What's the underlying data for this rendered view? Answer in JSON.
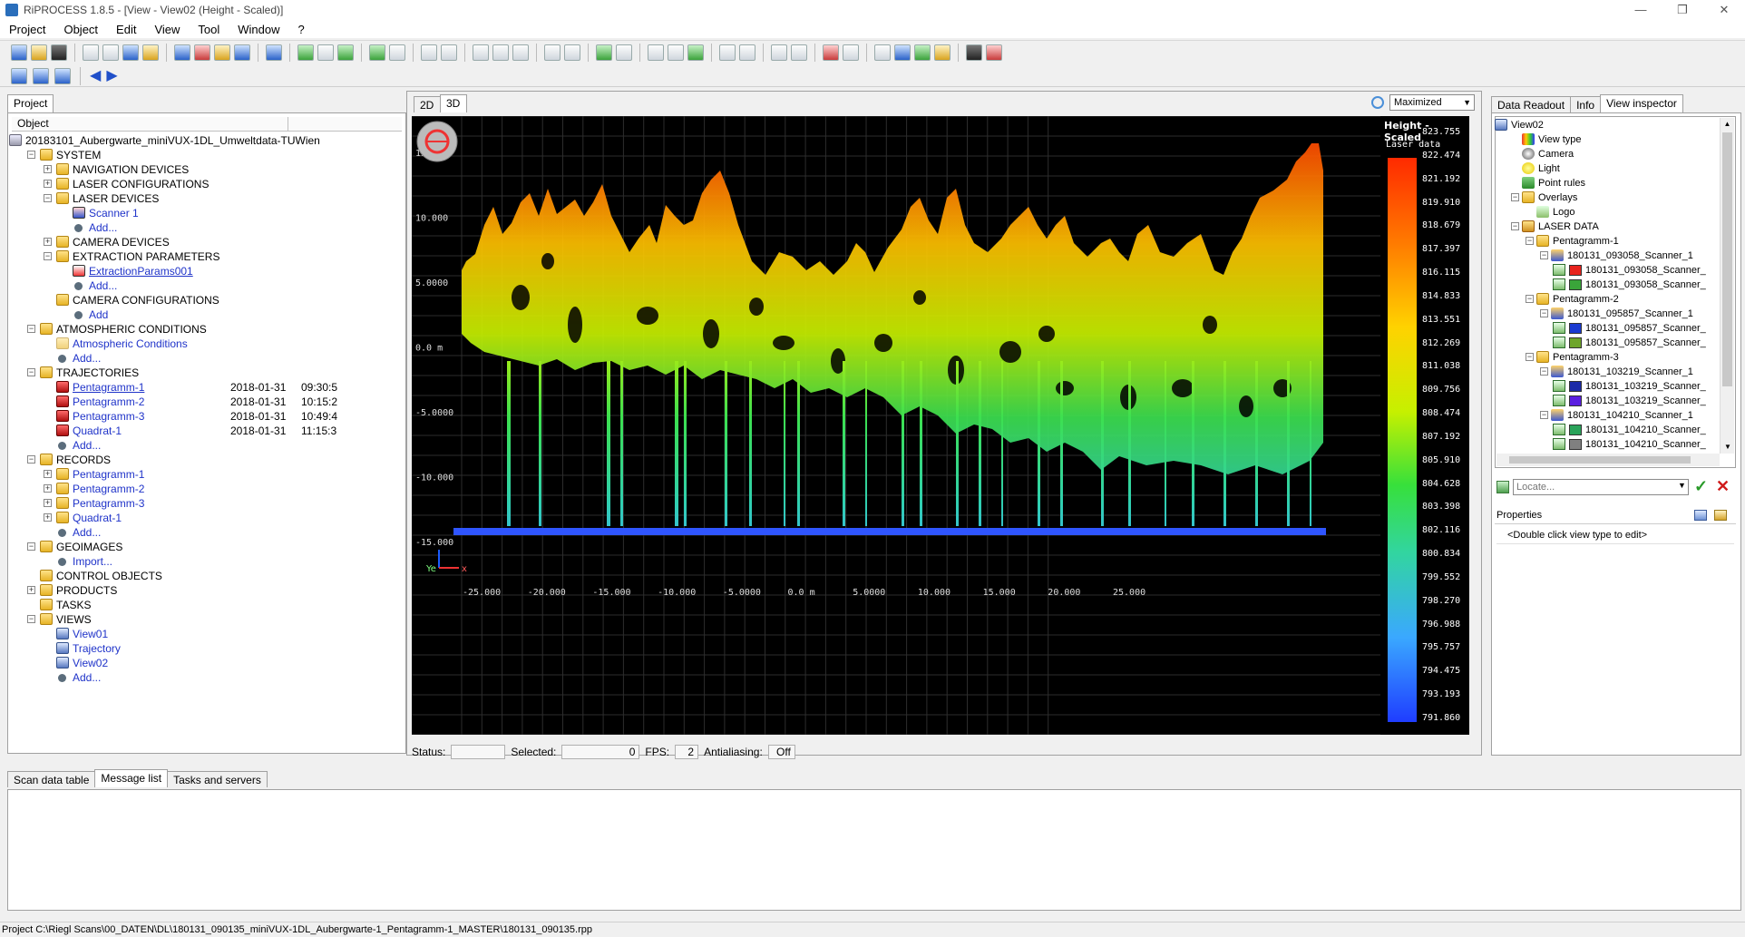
{
  "window": {
    "title": "RiPROCESS 1.8.5 - [View - View02 (Height - Scaled)]",
    "controls": [
      "—",
      "❐",
      "✕"
    ]
  },
  "menu": [
    "Project",
    "Object",
    "Edit",
    "View",
    "Tool",
    "Window",
    "?"
  ],
  "left_panel": {
    "tab": "Project",
    "column_header": "Object",
    "tree": [
      {
        "label": "20183101_Aubergwarte_miniVUX-1DL_Umweltdata-TUWien",
        "indent": 0,
        "type": "root"
      },
      {
        "label": "SYSTEM",
        "indent": 1,
        "type": "folder",
        "pm": "−"
      },
      {
        "label": "NAVIGATION DEVICES",
        "indent": 2,
        "type": "folder",
        "pm": "+"
      },
      {
        "label": "LASER CONFIGURATIONS",
        "indent": 2,
        "type": "folder",
        "pm": "+"
      },
      {
        "label": "LASER DEVICES",
        "indent": 2,
        "type": "folder",
        "pm": "−"
      },
      {
        "label": "Scanner 1",
        "indent": 3,
        "type": "scanner",
        "cls": "blue"
      },
      {
        "label": "Add...",
        "indent": 3,
        "type": "dot",
        "cls": "blue"
      },
      {
        "label": "CAMERA DEVICES",
        "indent": 2,
        "type": "folder",
        "pm": "+"
      },
      {
        "label": "EXTRACTION PARAMETERS",
        "indent": 2,
        "type": "folder",
        "pm": "−"
      },
      {
        "label": "ExtractionParams001",
        "indent": 3,
        "type": "param",
        "cls": "blue ul"
      },
      {
        "label": "Add...",
        "indent": 3,
        "type": "dot",
        "cls": "blue"
      },
      {
        "label": "CAMERA CONFIGURATIONS",
        "indent": 2,
        "type": "folder"
      },
      {
        "label": "Add",
        "indent": 3,
        "type": "dot",
        "cls": "blue"
      },
      {
        "label": "ATMOSPHERIC CONDITIONS",
        "indent": 1,
        "type": "folder",
        "pm": "−"
      },
      {
        "label": "Atmospheric Conditions",
        "indent": 2,
        "type": "folderlight",
        "cls": "blue"
      },
      {
        "label": "Add...",
        "indent": 2,
        "type": "dot",
        "cls": "blue"
      },
      {
        "label": "TRAJECTORIES",
        "indent": 1,
        "type": "folder",
        "pm": "−"
      },
      {
        "label": "Pentagramm-1",
        "indent": 2,
        "type": "traj",
        "cls": "blue ul",
        "date": "2018-01-31",
        "time": "09:30:5"
      },
      {
        "label": "Pentagramm-2",
        "indent": 2,
        "type": "traj",
        "cls": "blue",
        "date": "2018-01-31",
        "time": "10:15:2"
      },
      {
        "label": "Pentagramm-3",
        "indent": 2,
        "type": "traj",
        "cls": "blue",
        "date": "2018-01-31",
        "time": "10:49:4"
      },
      {
        "label": "Quadrat-1",
        "indent": 2,
        "type": "traj",
        "cls": "blue",
        "date": "2018-01-31",
        "time": "11:15:3"
      },
      {
        "label": "Add...",
        "indent": 2,
        "type": "dot",
        "cls": "blue"
      },
      {
        "label": "RECORDS",
        "indent": 1,
        "type": "folder",
        "pm": "−"
      },
      {
        "label": "Pentagramm-1",
        "indent": 2,
        "type": "folder",
        "pm": "+",
        "cls": "blue"
      },
      {
        "label": "Pentagramm-2",
        "indent": 2,
        "type": "folder",
        "pm": "+",
        "cls": "blue"
      },
      {
        "label": "Pentagramm-3",
        "indent": 2,
        "type": "folder",
        "pm": "+",
        "cls": "blue"
      },
      {
        "label": "Quadrat-1",
        "indent": 2,
        "type": "folder",
        "pm": "+",
        "cls": "blue"
      },
      {
        "label": "Add...",
        "indent": 2,
        "type": "dot",
        "cls": "blue"
      },
      {
        "label": "GEOIMAGES",
        "indent": 1,
        "type": "folder",
        "pm": "−"
      },
      {
        "label": "Import...",
        "indent": 2,
        "type": "dot",
        "cls": "blue"
      },
      {
        "label": "CONTROL OBJECTS",
        "indent": 1,
        "type": "folder"
      },
      {
        "label": "PRODUCTS",
        "indent": 1,
        "type": "folder",
        "pm": "+"
      },
      {
        "label": "TASKS",
        "indent": 1,
        "type": "folder"
      },
      {
        "label": "VIEWS",
        "indent": 1,
        "type": "folder",
        "pm": "−"
      },
      {
        "label": "View01",
        "indent": 2,
        "type": "view",
        "cls": "blue"
      },
      {
        "label": "Trajectory",
        "indent": 2,
        "type": "view",
        "cls": "blue"
      },
      {
        "label": "View02",
        "indent": 2,
        "type": "view",
        "cls": "blue"
      },
      {
        "label": "Add...",
        "indent": 2,
        "type": "dot",
        "cls": "blue"
      }
    ]
  },
  "view": {
    "tabs": [
      "2D",
      "3D"
    ],
    "layout_select": "Maximized",
    "legend_title": "Height - Scaled",
    "legend_subtitle": "Laser data",
    "legend_values": [
      "823.755",
      "822.474",
      "821.192",
      "819.910",
      "818.679",
      "817.397",
      "816.115",
      "814.833",
      "813.551",
      "812.269",
      "811.038",
      "809.756",
      "808.474",
      "807.192",
      "805.910",
      "804.628",
      "803.398",
      "802.116",
      "800.834",
      "799.552",
      "798.270",
      "796.988",
      "795.757",
      "794.475",
      "793.193",
      "791.860"
    ],
    "y_ticks": [
      "15.000",
      "10.000",
      "5.0000",
      "0.0 m",
      "-5.0000",
      "-10.000",
      "-15.000"
    ],
    "x_ticks": [
      "-25.000",
      "-20.000",
      "-15.000",
      "-10.000",
      "-5.0000",
      "0.0 m",
      "5.0000",
      "10.000",
      "15.000",
      "20.000",
      "25.000"
    ],
    "axis_labels": {
      "y": "Ye",
      "x": "x"
    }
  },
  "statusline": {
    "status_label": "Status:",
    "status_value": "",
    "selected_label": "Selected:",
    "selected_value": "0",
    "fps_label": "FPS:",
    "fps_value": "2",
    "aa_label": "Antialiasing:",
    "aa_value": "Off"
  },
  "right_panel": {
    "tabs": [
      "Data Readout",
      "Info",
      "View inspector"
    ],
    "tree": [
      {
        "label": "View02",
        "indent": 0,
        "type": "view",
        "pm": "−"
      },
      {
        "label": "View type",
        "indent": 1,
        "type": "viewtype"
      },
      {
        "label": "Camera",
        "indent": 1,
        "type": "camera"
      },
      {
        "label": "Light",
        "indent": 1,
        "type": "light"
      },
      {
        "label": "Point rules",
        "indent": 1,
        "type": "rules"
      },
      {
        "label": "Overlays",
        "indent": 1,
        "type": "folder",
        "pm": "−"
      },
      {
        "label": "Logo",
        "indent": 2,
        "type": "logo"
      },
      {
        "label": "LASER DATA",
        "indent": 1,
        "type": "laser",
        "pm": "−"
      },
      {
        "label": "Pentagramm-1",
        "indent": 2,
        "type": "folder",
        "pm": "−"
      },
      {
        "label": "180131_093058_Scanner_1",
        "indent": 3,
        "type": "scan",
        "pm": "−"
      },
      {
        "label": "180131_093058_Scanner_",
        "indent": 4,
        "type": "swatch",
        "color": "#e8231d"
      },
      {
        "label": "180131_093058_Scanner_",
        "indent": 4,
        "type": "swatch",
        "color": "#3aa53a"
      },
      {
        "label": "Pentagramm-2",
        "indent": 2,
        "type": "folder",
        "pm": "−"
      },
      {
        "label": "180131_095857_Scanner_1",
        "indent": 3,
        "type": "scan",
        "pm": "−"
      },
      {
        "label": "180131_095857_Scanner_",
        "indent": 4,
        "type": "swatch",
        "color": "#1a3ad1"
      },
      {
        "label": "180131_095857_Scanner_",
        "indent": 4,
        "type": "swatch",
        "color": "#6ea52a"
      },
      {
        "label": "Pentagramm-3",
        "indent": 2,
        "type": "folder",
        "pm": "−"
      },
      {
        "label": "180131_103219_Scanner_1",
        "indent": 3,
        "type": "scan",
        "pm": "−"
      },
      {
        "label": "180131_103219_Scanner_",
        "indent": 4,
        "type": "swatch",
        "color": "#1b2aa8"
      },
      {
        "label": "180131_103219_Scanner_",
        "indent": 4,
        "type": "swatch",
        "color": "#5a1ee0"
      },
      {
        "label": "180131_104210_Scanner_1",
        "indent": 3,
        "type": "scan",
        "pm": "−"
      },
      {
        "label": "180131_104210_Scanner_",
        "indent": 4,
        "type": "swatch",
        "color": "#2aa35a"
      },
      {
        "label": "180131_104210_Scanner_",
        "indent": 4,
        "type": "swatch",
        "color": "#808080"
      }
    ],
    "locate_placeholder": "Locate...",
    "properties_label": "Properties",
    "properties_hint": "<Double click view type to edit>"
  },
  "bottom_tabs": [
    "Scan data table",
    "Message list",
    "Tasks and servers"
  ],
  "statusbar": "Project C:\\Riegl Scans\\00_DATEN\\DL\\180131_090135_miniVUX-1DL_Aubergwarte-1_Pentagramm-1_MASTER\\180131_090135.rpp"
}
